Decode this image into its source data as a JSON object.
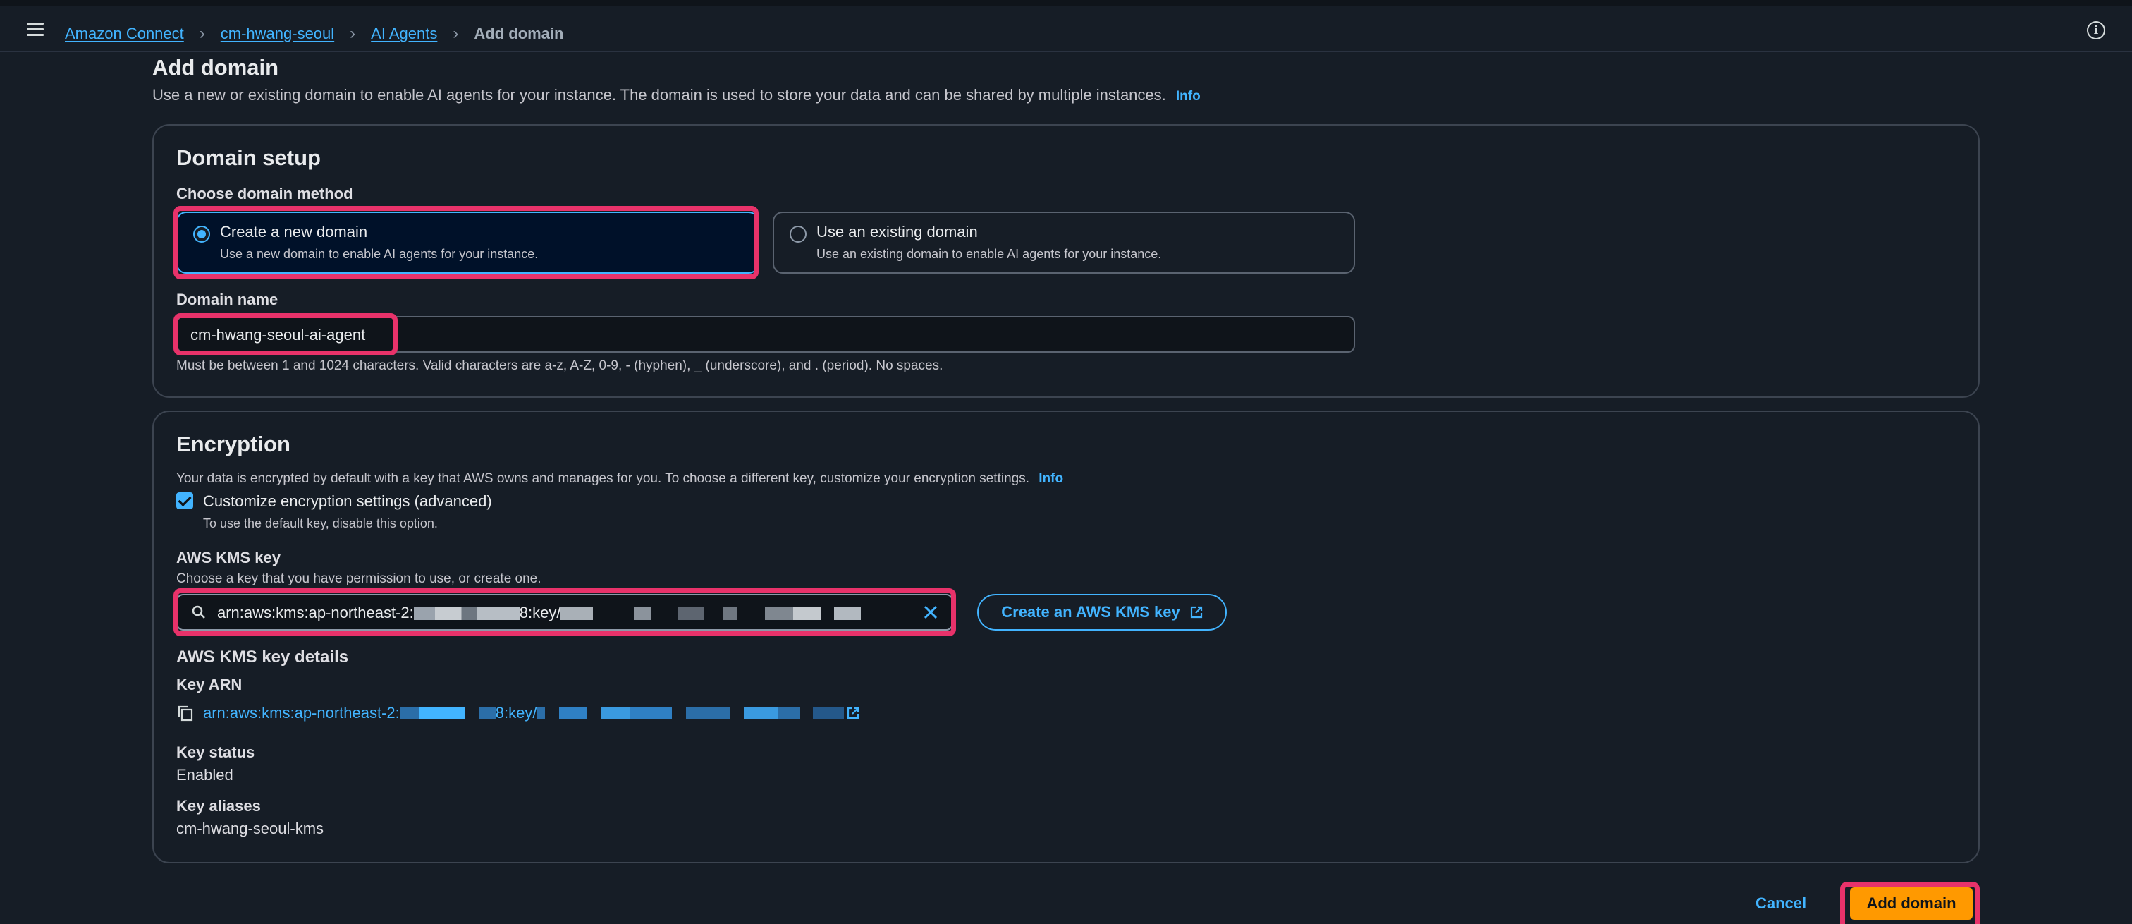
{
  "breadcrumb": {
    "items": [
      "Amazon Connect",
      "cm-hwang-seoul",
      "AI Agents"
    ],
    "current": "Add domain"
  },
  "page": {
    "title": "Add domain",
    "description": "Use a new or existing domain to enable AI agents for your instance. The domain is used to store your data and can be shared by multiple instances.",
    "info": "Info"
  },
  "domain_setup": {
    "title": "Domain setup",
    "method_label": "Choose domain method",
    "options": [
      {
        "label": "Create a new domain",
        "description": "Use a new domain to enable AI agents for your instance.",
        "selected": true
      },
      {
        "label": "Use an existing domain",
        "description": "Use an existing domain to enable AI agents for your instance.",
        "selected": false
      }
    ],
    "name_label": "Domain name",
    "name_value": "cm-hwang-seoul-ai-agent",
    "name_hint": "Must be between 1 and 1024 characters. Valid characters are a-z, A-Z, 0-9, - (hyphen), _ (underscore), and . (period). No spaces."
  },
  "encryption": {
    "title": "Encryption",
    "description": "Your data is encrypted by default with a key that AWS owns and manages for you. To choose a different key, customize your encryption settings.",
    "info": "Info",
    "customize_label": "Customize encryption settings (advanced)",
    "customize_hint": "To use the default key, disable this option.",
    "customize_checked": true,
    "kms_label": "AWS KMS key",
    "kms_hint": "Choose a key that you have permission to use, or create one.",
    "kms_value_prefix": "arn:aws:kms:ap-northeast-2:",
    "kms_value_mid": "8:key/",
    "create_key_button": "Create an AWS KMS key",
    "details_title": "AWS KMS key details",
    "key_arn_label": "Key ARN",
    "key_arn_prefix": "arn:aws:kms:ap-northeast-2:",
    "key_arn_mid": "8:key/",
    "key_status_label": "Key status",
    "key_status_value": "Enabled",
    "key_aliases_label": "Key aliases",
    "key_aliases_value": "cm-hwang-seoul-kms"
  },
  "actions": {
    "cancel": "Cancel",
    "submit": "Add domain"
  },
  "colors": {
    "accent": "#42b4ff",
    "primary_button": "#ff9900",
    "highlight": "#e8326a",
    "background": "#161d26"
  }
}
